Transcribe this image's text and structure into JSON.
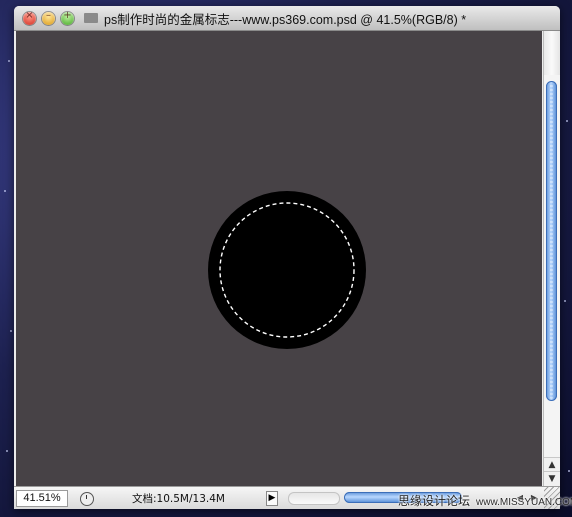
{
  "window": {
    "title": "ps制作时尚的金属标志---www.ps369.com.psd @ 41.5%(RGB/8) *"
  },
  "titlebar_buttons": {
    "close_symbol": "×",
    "minimize_symbol": "–",
    "zoom_symbol": "+"
  },
  "canvas": {
    "background_color": "#474246",
    "shape": "black-circle",
    "shape_color": "#000000",
    "selection": "dashed-circle-marquee"
  },
  "statusbar": {
    "zoom_value": "41.51%",
    "doc_info": "文档:10.5M/13.4M",
    "menu_arrow": "▶"
  },
  "scrollbars": {
    "up_arrow": "▲",
    "down_arrow": "▼",
    "left_arrow": "◀",
    "right_arrow": "▶"
  },
  "watermark": {
    "site_name": "思缘设计论坛",
    "url": "www.MISSYUAN.COM"
  },
  "icons": {
    "status_icon": "clock-icon",
    "doc_icon": "document-proxy-icon"
  }
}
